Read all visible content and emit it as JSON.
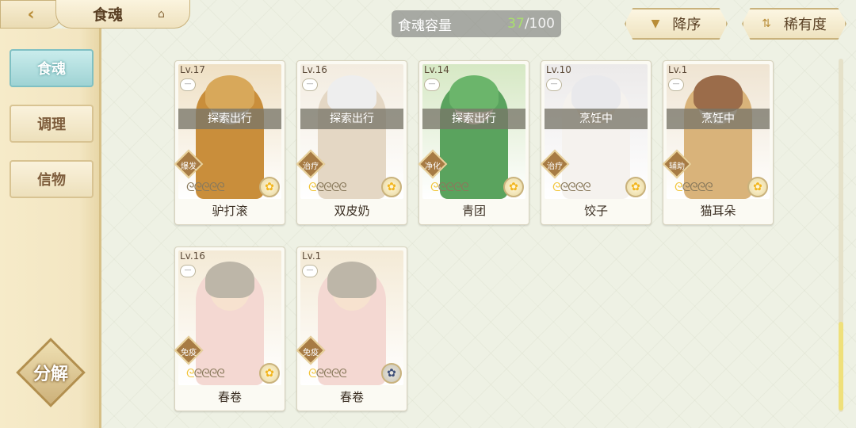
{
  "header": {
    "back_icon": "back-arrow-icon",
    "title": "食魂",
    "home_icon": "pavilion-icon",
    "capacity_label": "食魂容量",
    "capacity_current": "37",
    "capacity_max": "/100",
    "sort_order_label": "降序",
    "sort_order_icon": "triangle-down-icon",
    "sort_by_label": "稀有度",
    "sort_by_icon": "sort-arrows-icon"
  },
  "sidebar": {
    "tabs": [
      {
        "label": "食魂",
        "active": true
      },
      {
        "label": "调理",
        "active": false
      },
      {
        "label": "信物",
        "active": false
      }
    ],
    "decompose_label": "分解"
  },
  "cards": [
    {
      "level": "Lv.17",
      "status": "探索出行",
      "role": "爆发",
      "stars": 0,
      "name": "驴打滚",
      "element": "gold",
      "hair": "#d8a85a",
      "outfit": "#c98e3b",
      "bg": "#efe0c4"
    },
    {
      "level": "Lv.16",
      "status": "探索出行",
      "role": "治疗",
      "stars": 1,
      "name": "双皮奶",
      "element": "gold",
      "hair": "#eeeeee",
      "outfit": "#e4d7c4",
      "bg": "#f3ece0"
    },
    {
      "level": "Lv.14",
      "status": "探索出行",
      "role": "净化",
      "stars": 1,
      "name": "青团",
      "element": "gold",
      "hair": "#6bb56b",
      "outfit": "#5aa35e",
      "bg": "#d6e8c4"
    },
    {
      "level": "Lv.10",
      "status": "烹饪中",
      "role": "治疗",
      "stars": 1,
      "name": "饺子",
      "element": "gold",
      "hair": "#e9e9ec",
      "outfit": "#f5f2ee",
      "bg": "#eceaea"
    },
    {
      "level": "Lv.1",
      "status": "烹饪中",
      "role": "辅助",
      "stars": 1,
      "name": "猫耳朵",
      "element": "gold",
      "hair": "#9b6c4a",
      "outfit": "#d9b37a",
      "bg": "#efe4d2"
    },
    {
      "level": "Lv.16",
      "status": "",
      "role": "免疫",
      "stars": 1,
      "name": "春卷",
      "element": "gold",
      "hair": "#bdb6a8",
      "outfit": "#f4d8d2",
      "bg": "#f4ead6"
    },
    {
      "level": "Lv.1",
      "status": "",
      "role": "免疫",
      "stars": 1,
      "name": "春卷",
      "element": "blue",
      "hair": "#bdb6a8",
      "outfit": "#f4d8d2",
      "bg": "#f4ead6"
    }
  ]
}
